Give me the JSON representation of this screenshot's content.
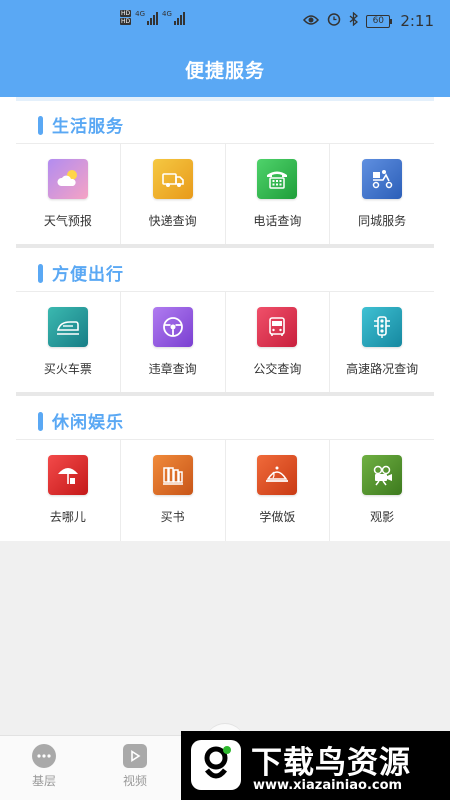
{
  "status_bar": {
    "time": "2:11",
    "battery": "60",
    "hd1": "HD",
    "hd2": "HD",
    "net1": "4G",
    "net2": "4G"
  },
  "header": {
    "title": "便捷服务"
  },
  "sections": [
    {
      "title": "生活服务",
      "items": [
        {
          "label": "天气预报",
          "icon": "weather-icon"
        },
        {
          "label": "快递查询",
          "icon": "delivery-truck-icon"
        },
        {
          "label": "电话查询",
          "icon": "telephone-icon"
        },
        {
          "label": "同城服务",
          "icon": "courier-scooter-icon"
        }
      ]
    },
    {
      "title": "方便出行",
      "items": [
        {
          "label": "买火车票",
          "icon": "train-icon"
        },
        {
          "label": "违章查询",
          "icon": "steering-wheel-icon"
        },
        {
          "label": "公交查询",
          "icon": "bus-icon"
        },
        {
          "label": "高速路况查询",
          "icon": "traffic-light-icon"
        }
      ]
    },
    {
      "title": "休闲娱乐",
      "items": [
        {
          "label": "去哪儿",
          "icon": "beach-umbrella-icon"
        },
        {
          "label": "买书",
          "icon": "books-icon"
        },
        {
          "label": "学做饭",
          "icon": "cooking-dish-icon"
        },
        {
          "label": "观影",
          "icon": "movie-camera-icon"
        }
      ]
    }
  ],
  "tabbar": {
    "tab1": "基层",
    "tab2": "视频"
  },
  "watermark": {
    "title": "下载鸟资源",
    "url": "www.xiazainiao.com"
  },
  "colors": {
    "accent": "#5aa8f4",
    "background": "#f0f0f0"
  }
}
